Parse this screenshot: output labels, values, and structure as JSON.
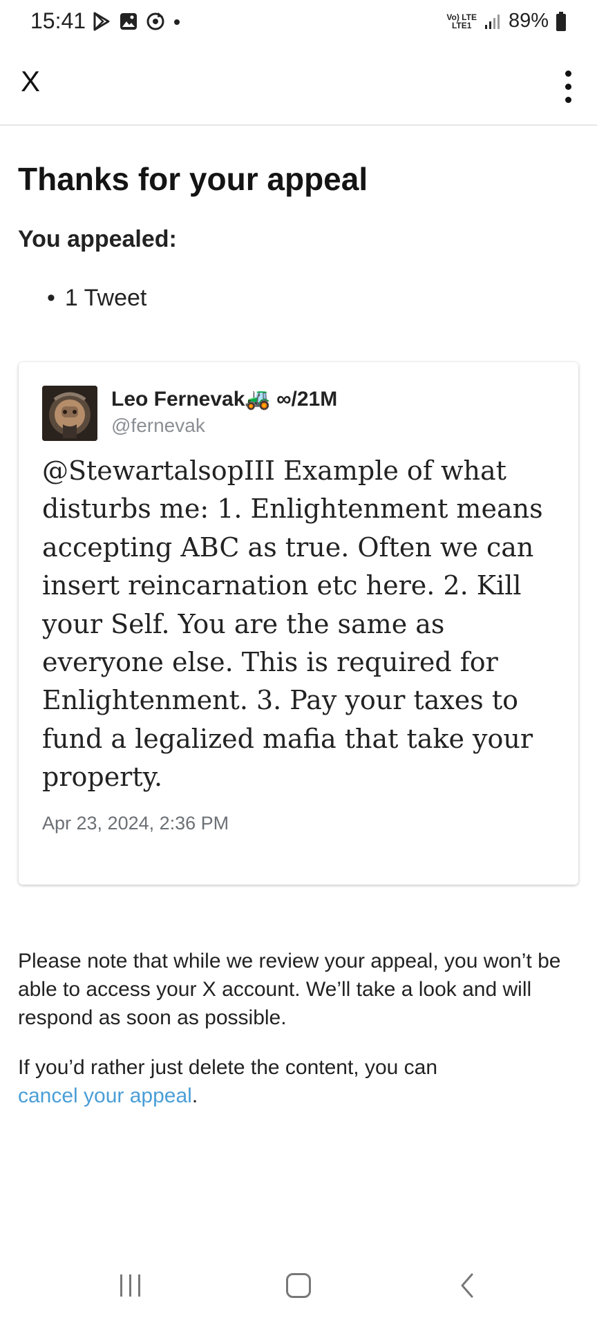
{
  "status_bar": {
    "time": "15:41",
    "network_top": "Vo) LTE",
    "network_bottom": "LTE1",
    "battery": "89%"
  },
  "app_bar": {
    "close_label": "X",
    "menu_icon": "more-vertical-icon"
  },
  "page": {
    "title": "Thanks for your appeal",
    "appealed_label": "You appealed:",
    "appealed_items": [
      "1 Tweet"
    ]
  },
  "tweet": {
    "author_name": "Leo Fernevak🚜 ∞/21M",
    "author_handle": "@fernevak",
    "text": "@StewartalsopIII Example of what disturbs me: 1. Enlightenment means accepting ABC as true. Often we can insert reincarnation etc here. 2. Kill your Self. You are the same as everyone else. This is required for Enlightenment. 3. Pay your taxes to fund a legalized mafia that take your property.",
    "timestamp": "Apr 23, 2024, 2:36 PM"
  },
  "notes": {
    "review_notice": "Please note that while we review your appeal, you won’t be able to access your X account. We’ll take a look and will respond as soon as possible.",
    "delete_prefix": "If you’d rather just delete the content, you can",
    "cancel_link": "cancel your appeal",
    "delete_suffix": "."
  },
  "colors": {
    "link": "#4a9ed6",
    "handle": "#8a8f94",
    "divider": "#e6e6e6"
  }
}
